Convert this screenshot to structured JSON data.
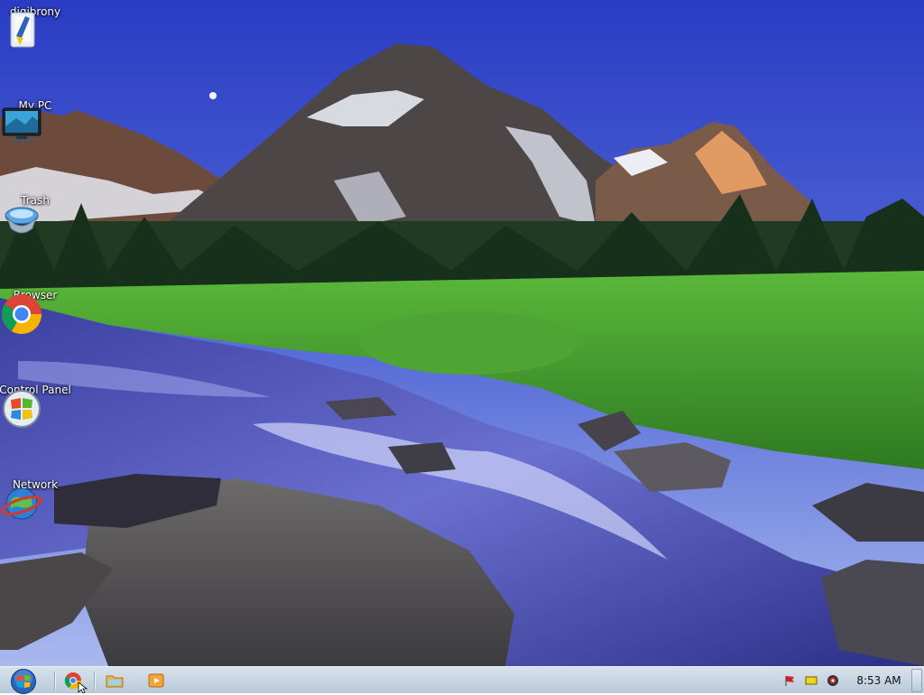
{
  "desktop": {
    "icons": [
      {
        "label": "digibrony",
        "icon": "user-folder-icon"
      },
      {
        "label": "My PC",
        "icon": "computer-monitor-icon"
      },
      {
        "label": "Trash",
        "icon": "trash-bin-icon"
      },
      {
        "label": "Browser",
        "icon": "chrome-icon"
      },
      {
        "label": "Control Panel",
        "icon": "control-panel-icon"
      },
      {
        "label": "Network",
        "icon": "network-globe-icon"
      }
    ]
  },
  "taskbar": {
    "start_icon": "windows-orb-icon",
    "pinned": [
      {
        "icon": "chrome-icon"
      },
      {
        "icon": "file-explorer-icon"
      },
      {
        "icon": "media-player-icon"
      }
    ],
    "tray": [
      {
        "icon": "action-center-flag-icon"
      },
      {
        "icon": "battery-icon"
      },
      {
        "icon": "volume-icon"
      }
    ],
    "clock": "8:53 AM"
  },
  "colors": {
    "sky_top": "#2d3fc6",
    "sky_bottom": "#8aa4e8",
    "grass": "#3f9a2a",
    "water": "#4a50b0",
    "taskbar": "#c6d3e0"
  }
}
